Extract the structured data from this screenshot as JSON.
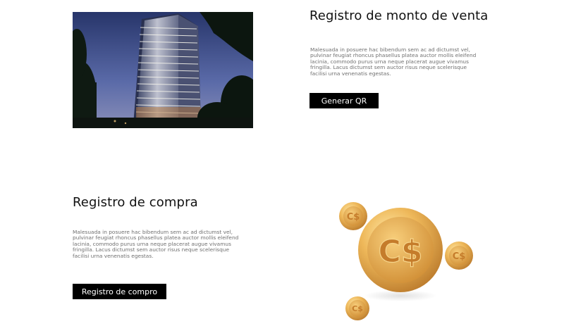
{
  "section_sales": {
    "title": "Registro de monto de venta",
    "body": "Malesuada in posuere hac bibendum sem ac ad dictumst vel, pulvinar feugiat rhoncus phasellus platea auctor mollis eleifend lacinia, commodo purus urna neque placerat augue vivamus fringilla. Lacus dictumst sem auctor risus neque scelerisque facilisi urna venenatis egestas.",
    "button_label": "Generar QR",
    "image_icon": "building-photo"
  },
  "section_purchase": {
    "title": "Registro de compra",
    "body": "Malesuada in posuere hac bibendum sem ac ad dictumst vel, pulvinar feugiat rhoncus phasellus platea auctor mollis eleifend lacinia, commodo purus urna neque placerat augue vivamus fringilla. Lacus dictumst sem auctor risus neque scelerisque facilisi urna venenatis egestas.",
    "button_label": "Registro de compro",
    "image_icon": "coins-illustration",
    "coin_symbol": "C$"
  },
  "colors": {
    "button_bg": "#000000",
    "button_text": "#ffffff",
    "body_text": "#6f6f6f",
    "coin_gold": "#e9b45a"
  }
}
